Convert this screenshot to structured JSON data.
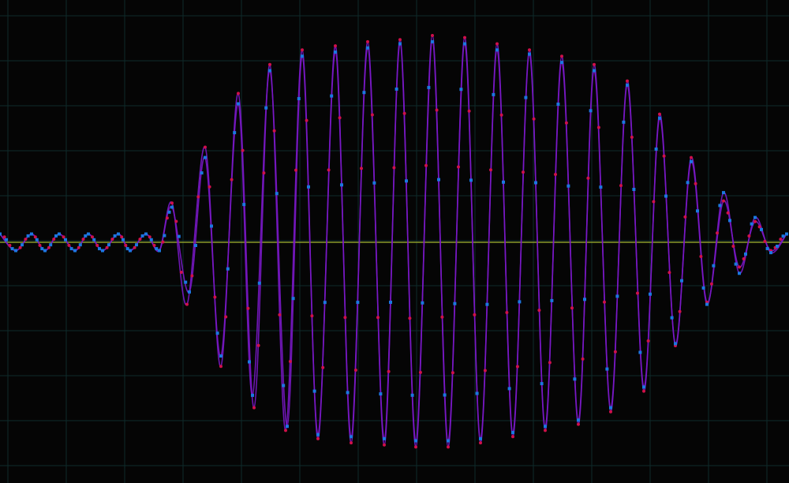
{
  "chart_data": {
    "type": "line",
    "title": "",
    "xlabel": "",
    "ylabel": "",
    "xlim": [
      0,
      1000
    ],
    "ylim": [
      -1,
      1
    ],
    "grid": true,
    "legend": "none",
    "background_color": "#050505",
    "grid_color": "#0f2a2a",
    "baseline_color": "#8a9a2a",
    "series": [
      {
        "color": "#d0104a",
        "line_color": "#7a18c8",
        "marker": "circle",
        "description_values": {
          "x": [
            0,
            20,
            40,
            57,
            75,
            95,
            112,
            130,
            150,
            165,
            185,
            202,
            218,
            237,
            260,
            280,
            302,
            322,
            342,
            362,
            383,
            403,
            425,
            445,
            466,
            487,
            507,
            527,
            548,
            568,
            589,
            609,
            630,
            650,
            671,
            691,
            712,
            733,
            753,
            774,
            795,
            816,
            836,
            856,
            876,
            896,
            917,
            937,
            957,
            977,
            997
          ],
          "y": [
            0.04,
            -0.04,
            0.04,
            -0.04,
            0.04,
            -0.04,
            0.04,
            -0.04,
            0.04,
            -0.04,
            0.04,
            -0.04,
            0.19,
            -0.3,
            0.46,
            -0.6,
            0.72,
            -0.8,
            0.86,
            -0.91,
            0.93,
            -0.95,
            0.95,
            -0.97,
            0.97,
            -0.98,
            0.98,
            -0.99,
            1.0,
            -0.99,
            0.99,
            -0.97,
            0.96,
            -0.94,
            0.93,
            -0.91,
            0.9,
            -0.88,
            0.86,
            -0.82,
            0.78,
            -0.72,
            0.62,
            -0.5,
            0.41,
            -0.29,
            0.2,
            -0.12,
            0.1,
            -0.04,
            0.04
          ]
        }
      },
      {
        "color": "#1a78e0",
        "line_color": "#7a18c8",
        "marker": "square",
        "description_values": {
          "x": [
            0,
            20,
            40,
            57,
            75,
            95,
            112,
            130,
            150,
            165,
            185,
            202,
            218,
            240,
            260,
            280,
            302,
            320,
            342,
            364,
            383,
            403,
            425,
            445,
            466,
            487,
            507,
            527,
            548,
            568,
            589,
            609,
            630,
            650,
            671,
            691,
            712,
            733,
            753,
            774,
            795,
            816,
            836,
            856,
            876,
            896,
            917,
            937,
            957,
            977,
            997
          ],
          "y": [
            0.04,
            -0.04,
            0.04,
            -0.04,
            0.04,
            -0.04,
            0.04,
            -0.04,
            0.04,
            -0.04,
            0.04,
            -0.04,
            0.17,
            -0.24,
            0.41,
            -0.55,
            0.67,
            -0.74,
            0.83,
            -0.89,
            0.9,
            -0.93,
            0.92,
            -0.94,
            0.94,
            -0.95,
            0.96,
            -0.96,
            0.97,
            -0.96,
            0.96,
            -0.95,
            0.93,
            -0.92,
            0.91,
            -0.89,
            0.87,
            -0.86,
            0.83,
            -0.8,
            0.76,
            -0.7,
            0.6,
            -0.49,
            0.39,
            -0.3,
            0.24,
            -0.15,
            0.12,
            -0.05,
            0.04
          ]
        }
      }
    ]
  }
}
